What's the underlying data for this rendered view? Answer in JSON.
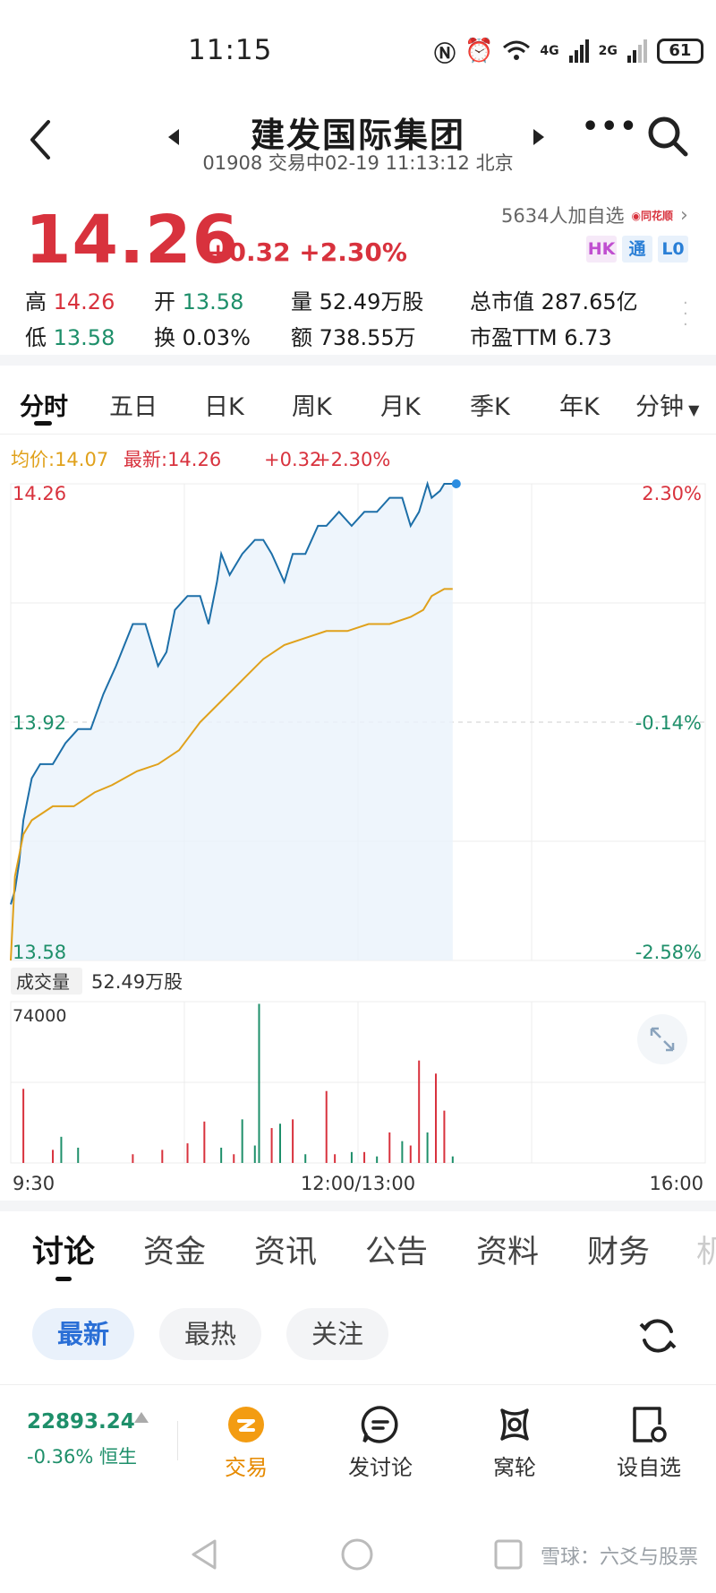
{
  "status": {
    "time": "11:15",
    "network1": "4G",
    "network2": "2G",
    "battery": "61"
  },
  "header": {
    "title": "建发国际集团",
    "subtitle": "01908 交易中02-19 11:13:12 北京"
  },
  "quote": {
    "price": "14.26",
    "change": "+0.32 +2.30%",
    "followers": "5634人加自选",
    "source_logo": "同花顺",
    "badges": [
      "HK",
      "通",
      "L0"
    ],
    "stats": [
      {
        "label": "高",
        "value": "14.26"
      },
      {
        "label": "开",
        "value": "13.58"
      },
      {
        "label": "量",
        "value": "52.49万股"
      },
      {
        "label": "总市值",
        "value": "287.65亿"
      },
      {
        "label": "低",
        "value": "13.58"
      },
      {
        "label": "换",
        "value": "0.03%"
      },
      {
        "label": "额",
        "value": "738.55万"
      },
      {
        "label": "市盈TTM",
        "value": "6.73"
      }
    ]
  },
  "kline_tabs": [
    "分时",
    "五日",
    "日K",
    "周K",
    "月K",
    "季K",
    "年K",
    "分钟"
  ],
  "chart_data": {
    "type": "line",
    "legend": {
      "avg": "均价:14.07",
      "latest": "最新:14.26",
      "chg": "+0.32",
      "pct": "+2.30%"
    },
    "ylim": [
      13.58,
      14.26
    ],
    "y_labels_left": [
      "14.26",
      "13.92",
      "13.58"
    ],
    "y_labels_right": [
      "2.30%",
      "-0.14%",
      "-2.58%"
    ],
    "x_labels": [
      "9:30",
      "12:00/13:00",
      "16:00"
    ],
    "total_points": 330,
    "series": [
      {
        "x": [
          0,
          2,
          4,
          6,
          10,
          14,
          20,
          26,
          32,
          38,
          44,
          50,
          54,
          58,
          64,
          70,
          74,
          78,
          84,
          90,
          94,
          98,
          100,
          104,
          110,
          116,
          120,
          124,
          130,
          134,
          140,
          146,
          150,
          156,
          162,
          168,
          174,
          180,
          186,
          190,
          194,
          196,
          198,
          200,
          204,
          206,
          210
        ],
        "y": [
          13.66,
          13.68,
          13.72,
          13.78,
          13.84,
          13.86,
          13.86,
          13.89,
          13.91,
          13.91,
          13.96,
          14.0,
          14.03,
          14.06,
          14.06,
          14.0,
          14.02,
          14.08,
          14.1,
          14.1,
          14.06,
          14.12,
          14.16,
          14.13,
          14.16,
          14.18,
          14.18,
          14.16,
          14.12,
          14.16,
          14.16,
          14.2,
          14.2,
          14.22,
          14.2,
          14.22,
          14.22,
          14.24,
          14.24,
          14.2,
          14.22,
          14.24,
          14.26,
          14.24,
          14.25,
          14.26,
          14.26
        ]
      },
      {
        "x": [
          0,
          2,
          6,
          10,
          20,
          30,
          40,
          48,
          60,
          70,
          80,
          90,
          100,
          110,
          120,
          130,
          140,
          150,
          160,
          170,
          180,
          190,
          196,
          200,
          206,
          210
        ],
        "y": [
          13.58,
          13.7,
          13.76,
          13.78,
          13.8,
          13.8,
          13.82,
          13.83,
          13.85,
          13.86,
          13.88,
          13.92,
          13.95,
          13.98,
          14.01,
          14.03,
          14.04,
          14.05,
          14.05,
          14.06,
          14.06,
          14.07,
          14.08,
          14.1,
          14.11,
          14.11
        ]
      }
    ],
    "volume": {
      "label": "成交量",
      "total": "52.49万股",
      "max_label": "74000",
      "ymax": 74000,
      "bars": [
        {
          "x": 6,
          "v": 34000,
          "c": "r"
        },
        {
          "x": 20,
          "v": 6000,
          "c": "r"
        },
        {
          "x": 24,
          "v": 12000,
          "c": "g"
        },
        {
          "x": 32,
          "v": 7000,
          "c": "g"
        },
        {
          "x": 58,
          "v": 4000,
          "c": "r"
        },
        {
          "x": 72,
          "v": 6000,
          "c": "r"
        },
        {
          "x": 84,
          "v": 9000,
          "c": "r"
        },
        {
          "x": 92,
          "v": 19000,
          "c": "r"
        },
        {
          "x": 100,
          "v": 7000,
          "c": "g"
        },
        {
          "x": 106,
          "v": 4000,
          "c": "r"
        },
        {
          "x": 110,
          "v": 20000,
          "c": "g"
        },
        {
          "x": 116,
          "v": 8000,
          "c": "g"
        },
        {
          "x": 118,
          "v": 73000,
          "c": "g"
        },
        {
          "x": 124,
          "v": 16000,
          "c": "r"
        },
        {
          "x": 128,
          "v": 18000,
          "c": "g"
        },
        {
          "x": 134,
          "v": 20000,
          "c": "r"
        },
        {
          "x": 140,
          "v": 4000,
          "c": "g"
        },
        {
          "x": 150,
          "v": 33000,
          "c": "r"
        },
        {
          "x": 154,
          "v": 4000,
          "c": "r"
        },
        {
          "x": 162,
          "v": 5000,
          "c": "g"
        },
        {
          "x": 168,
          "v": 5000,
          "c": "r"
        },
        {
          "x": 174,
          "v": 3000,
          "c": "g"
        },
        {
          "x": 180,
          "v": 14000,
          "c": "r"
        },
        {
          "x": 186,
          "v": 10000,
          "c": "g"
        },
        {
          "x": 190,
          "v": 8000,
          "c": "r"
        },
        {
          "x": 194,
          "v": 47000,
          "c": "r"
        },
        {
          "x": 198,
          "v": 14000,
          "c": "g"
        },
        {
          "x": 202,
          "v": 41000,
          "c": "r"
        },
        {
          "x": 206,
          "v": 24000,
          "c": "r"
        },
        {
          "x": 210,
          "v": 3000,
          "c": "g"
        }
      ]
    }
  },
  "bottom_tabs": [
    "讨论",
    "资金",
    "资讯",
    "公告",
    "资料",
    "财务",
    "机"
  ],
  "filter_pills": [
    "最新",
    "最热",
    "关注"
  ],
  "index_ticker": {
    "value": "22893.24",
    "change": "-0.36%",
    "name": "恒生"
  },
  "footer_items": [
    "交易",
    "发讨论",
    "窝轮",
    "设自选"
  ],
  "watermark": "雪球：六爻与股票",
  "colors": {
    "up": "#d8323d",
    "down": "#1e8f6a",
    "price_line": "#1d6fa8",
    "avg_line": "#e0a11b",
    "accent": "#2a6fd6"
  }
}
